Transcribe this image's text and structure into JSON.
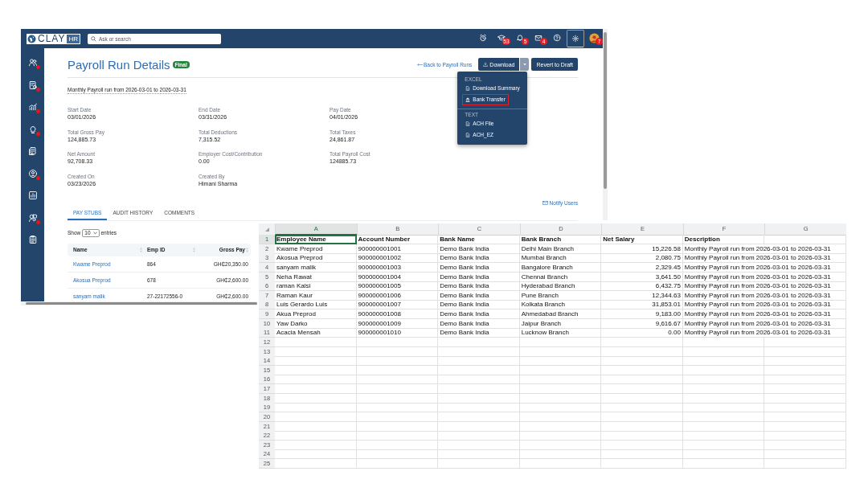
{
  "topbar": {
    "logo": "CLAY",
    "logo_suffix": "HR",
    "search": {
      "placeholder": "Ask or search"
    },
    "icons": [
      {
        "kind": "clock",
        "selected": false
      },
      {
        "kind": "cap",
        "badge": "53",
        "selected": false
      },
      {
        "kind": "bell",
        "badge": "5",
        "selected": false
      },
      {
        "kind": "mail",
        "badge": "4",
        "selected": false
      },
      {
        "kind": "help",
        "selected": false
      },
      {
        "kind": "settings",
        "selected": true
      },
      {
        "kind": "avatar",
        "badge": "7",
        "selected": false
      }
    ]
  },
  "sidebar": {
    "items": [
      {
        "kind": "people",
        "alert": true
      },
      {
        "kind": "report",
        "alert": true
      },
      {
        "kind": "chart",
        "alert": true
      },
      {
        "kind": "bulb",
        "alert": true
      },
      {
        "kind": "docs",
        "alert": false
      },
      {
        "kind": "user",
        "alert": true
      },
      {
        "kind": "bars",
        "alert": false
      },
      {
        "kind": "team",
        "alert": true
      },
      {
        "kind": "clipboard",
        "alert": false
      }
    ]
  },
  "page": {
    "title": "Payroll Run Details",
    "status": "Final",
    "back_link": "Back to Payroll Runs",
    "download_button": "Download",
    "revert_button": "Revert to Draft",
    "download_menu": {
      "sections": [
        {
          "heading": "EXCEL",
          "items": [
            {
              "label": "Download Summary",
              "selected": false
            },
            {
              "label": "Bank Transfer",
              "selected": true
            }
          ]
        },
        {
          "heading": "TEXT",
          "items": [
            {
              "label": "ACH File",
              "selected": false
            },
            {
              "label": "ACH_EZ",
              "selected": false
            }
          ]
        }
      ]
    },
    "description": "Monthly Payroll run from 2026-03-01 to 2026-03-31",
    "fields": [
      {
        "label": "Start Date",
        "value": "03/01/2026"
      },
      {
        "label": "End Date",
        "value": "03/31/2026"
      },
      {
        "label": "Pay Date",
        "value": "04/01/2026"
      },
      {
        "label": "Total Gross Pay",
        "value": "124,885.73"
      },
      {
        "label": "Total Deductions",
        "value": "7,315.52"
      },
      {
        "label": "Total Taxes",
        "value": "24,861.87"
      },
      {
        "label": "Net Amount",
        "value": "92,708.33"
      },
      {
        "label": "Employer Cost/Contribution",
        "value": "0.00"
      },
      {
        "label": "Total Payroll Cost",
        "value": "124885.73"
      },
      {
        "label": "Created On",
        "value": "03/23/2026"
      },
      {
        "label": "Created By",
        "value": "Himani Sharma"
      }
    ],
    "notify_link": "Notify Users",
    "tabs": [
      {
        "label": "PAY STUBS",
        "selected": true
      },
      {
        "label": "AUDIT HISTORY",
        "selected": false
      },
      {
        "label": "COMMENTS",
        "selected": false
      }
    ],
    "entries": {
      "prefix": "Show",
      "value": "10",
      "suffix": "entries"
    },
    "pay_stubs": {
      "columns": [
        "Name",
        "Emp ID",
        "Gross Pay"
      ],
      "rows": [
        [
          "Kwame Preprod",
          "864",
          "GH₵20,350.00"
        ],
        [
          "Akosua Preprod",
          "678",
          "GH₵2,600.00"
        ],
        [
          "sanyam malik",
          "27-22172556-0",
          "GH₵2,600.00"
        ]
      ]
    }
  },
  "spreadsheet": {
    "columns": [
      {
        "label": "A",
        "selected": true
      },
      {
        "label": "B",
        "selected": false
      },
      {
        "label": "C",
        "selected": false
      },
      {
        "label": "D",
        "selected": false
      },
      {
        "label": "E",
        "selected": false
      },
      {
        "label": "F",
        "selected": false
      },
      {
        "label": "G",
        "selected": false
      }
    ],
    "row_numbers": [
      {
        "label": "1",
        "selected": true
      },
      {
        "label": "2",
        "selected": false
      },
      {
        "label": "3",
        "selected": false
      },
      {
        "label": "4",
        "selected": false
      },
      {
        "label": "5",
        "selected": false
      },
      {
        "label": "6",
        "selected": false
      },
      {
        "label": "7",
        "selected": false
      },
      {
        "label": "8",
        "selected": false
      },
      {
        "label": "9",
        "selected": false
      },
      {
        "label": "10",
        "selected": false
      },
      {
        "label": "11",
        "selected": false
      },
      {
        "label": "12",
        "selected": false
      },
      {
        "label": "13",
        "selected": false
      },
      {
        "label": "14",
        "selected": false
      },
      {
        "label": "15",
        "selected": false
      },
      {
        "label": "16",
        "selected": false
      },
      {
        "label": "17",
        "selected": false
      },
      {
        "label": "18",
        "selected": false
      },
      {
        "label": "19",
        "selected": false
      },
      {
        "label": "20",
        "selected": false
      },
      {
        "label": "21",
        "selected": false
      },
      {
        "label": "22",
        "selected": false
      },
      {
        "label": "23",
        "selected": false
      },
      {
        "label": "24",
        "selected": false
      },
      {
        "label": "25",
        "selected": false
      }
    ],
    "rows": [
      [
        "Employee Name",
        "Account Number",
        "Bank Name",
        "Bank Branch",
        "Net Salary",
        "Description"
      ],
      [
        "Kwame Preprod",
        "900000001001",
        "Demo Bank India",
        "Delhi Main Branch",
        "15,226.58",
        "Monthly Payroll run from 2026-03-01 to 2026-03-31"
      ],
      [
        "Akosua Preprod",
        "900000001002",
        "Demo Bank India",
        "Mumbai Branch",
        "2,080.75",
        "Monthly Payroll run from 2026-03-01 to 2026-03-31"
      ],
      [
        "sanyam malik",
        "900000001003",
        "Demo Bank India",
        "Bangalore Branch",
        "2,329.45",
        "Monthly Payroll run from 2026-03-01 to 2026-03-31"
      ],
      [
        "Neha Rawat",
        "900000001004",
        "Demo Bank India",
        "Chennai Branch",
        "3,641.50",
        "Monthly Payroll run from 2026-03-01 to 2026-03-31"
      ],
      [
        "raman Kalsi",
        "900000001005",
        "Demo Bank India",
        "Hyderabad Branch",
        "6,432.75",
        "Monthly Payroll run from 2026-03-01 to 2026-03-31"
      ],
      [
        "Raman Kaur",
        "900000001006",
        "Demo Bank India",
        "Pune Branch",
        "12,344.63",
        "Monthly Payroll run from 2026-03-01 to 2026-03-31"
      ],
      [
        "Luis Gerardo Luis",
        "900000001007",
        "Demo Bank India",
        "Kolkata Branch",
        "31,853.01",
        "Monthly Payroll run from 2026-03-01 to 2026-03-31"
      ],
      [
        "Akua Preprod",
        "900000001008",
        "Demo Bank India",
        "Ahmedabad Branch",
        "9,183.00",
        "Monthly Payroll run from 2026-03-01 to 2026-03-31"
      ],
      [
        "Yaw Darko",
        "900000001009",
        "Demo Bank India",
        "Jaipur Branch",
        "9,616.67",
        "Monthly Payroll run from 2026-03-01 to 2026-03-31"
      ],
      [
        "Acacia Mensah",
        "900000001010",
        "Demo Bank India",
        "Lucknow Branch",
        "0.00",
        "Monthly Payroll run from 2026-03-01 to 2026-03-31"
      ]
    ]
  }
}
